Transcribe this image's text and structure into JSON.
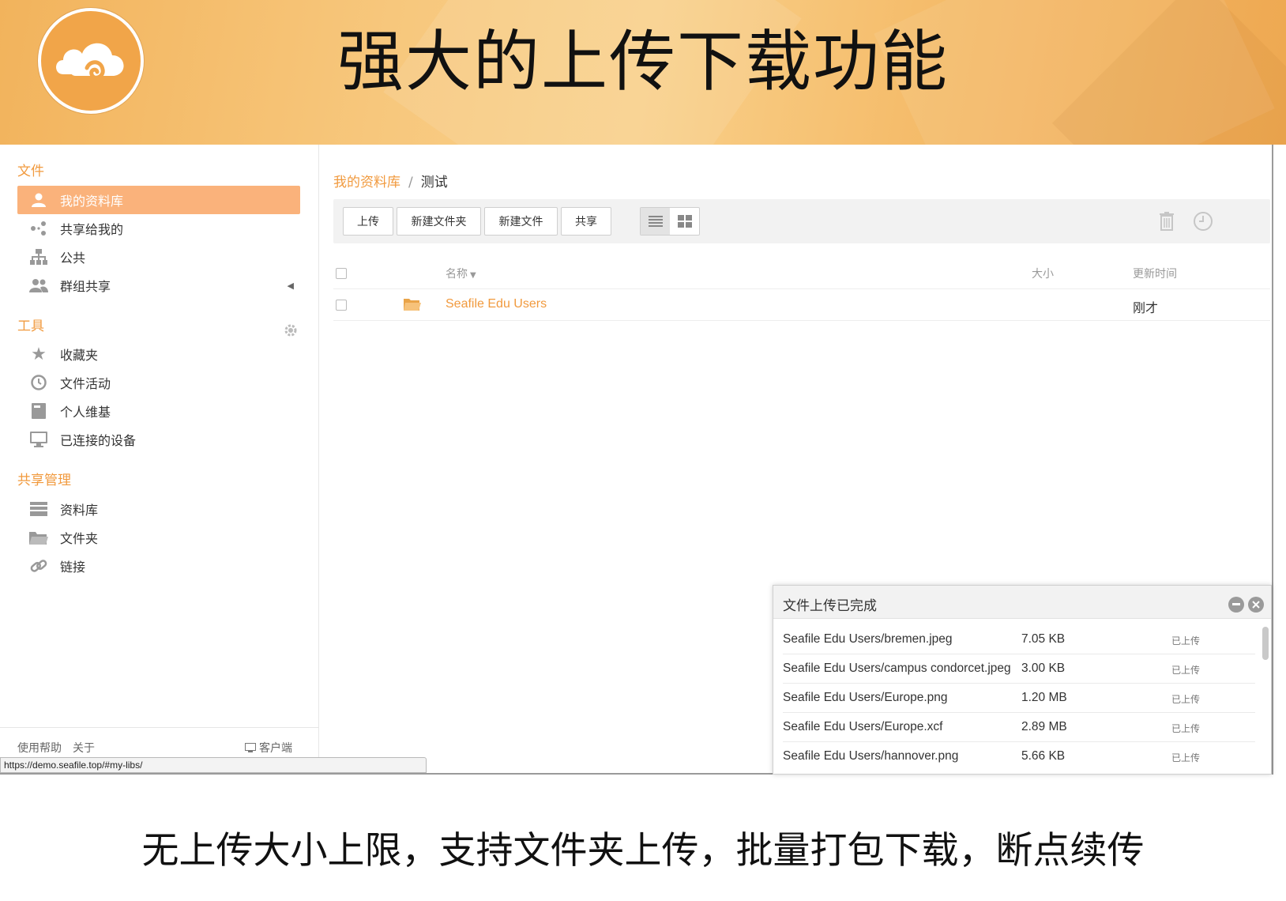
{
  "banner": {
    "title": "强大的上传下载功能",
    "logo_icon": "seafile-cloud-icon",
    "colors": {
      "gradient_start": "#f2b35c",
      "gradient_end": "#eea851"
    }
  },
  "sidebar": {
    "sections": [
      {
        "heading": "文件"
      },
      {
        "heading": "工具"
      },
      {
        "heading": "共享管理"
      }
    ],
    "files_items": [
      {
        "label": "我的资料库",
        "icon": "user-icon",
        "active": true
      },
      {
        "label": "共享给我的",
        "icon": "share-icon"
      },
      {
        "label": "公共",
        "icon": "org-tree-icon"
      },
      {
        "label": "群组共享",
        "icon": "group-icon"
      }
    ],
    "tools_items": [
      {
        "label": "收藏夹",
        "icon": "star-icon"
      },
      {
        "label": "文件活动",
        "icon": "history-icon"
      },
      {
        "label": "个人维基",
        "icon": "wiki-book-icon"
      },
      {
        "label": "已连接的设备",
        "icon": "monitor-icon"
      }
    ],
    "share_items": [
      {
        "label": "资料库",
        "icon": "library-icon"
      },
      {
        "label": "文件夹",
        "icon": "folder-icon"
      },
      {
        "label": "链接",
        "icon": "link-icon"
      }
    ],
    "footer": {
      "help": "使用帮助",
      "about": "关于",
      "client": "客户端"
    }
  },
  "status_bar": {
    "url": "https://demo.seafile.top/#my-libs/"
  },
  "breadcrumb": {
    "library": "我的资料库",
    "separator": "/",
    "current": "测试"
  },
  "toolbar": {
    "upload": "上传",
    "new_folder": "新建文件夹",
    "new_file": "新建文件",
    "share": "共享"
  },
  "table": {
    "headers": {
      "name": "名称",
      "size": "大小",
      "updated": "更新时间"
    },
    "rows": [
      {
        "name": "Seafile Edu Users",
        "size": "",
        "updated": "刚才",
        "type": "folder"
      }
    ]
  },
  "upload_panel": {
    "title": "文件上传已完成",
    "items": [
      {
        "name": "Seafile Edu Users/bremen.jpeg",
        "size": "7.05 KB",
        "status": "已上传"
      },
      {
        "name": "Seafile Edu Users/campus condorcet.jpeg",
        "size": "3.00 KB",
        "status": "已上传"
      },
      {
        "name": "Seafile Edu Users/Europe.png",
        "size": "1.20 MB",
        "status": "已上传"
      },
      {
        "name": "Seafile Edu Users/Europe.xcf",
        "size": "2.89 MB",
        "status": "已上传"
      },
      {
        "name": "Seafile Edu Users/hannover.png",
        "size": "5.66 KB",
        "status": "已上传"
      }
    ]
  },
  "caption": "无上传大小上限，支持文件夹上传，批量打包下载，断点续传",
  "accent_color": "#f19a3e"
}
